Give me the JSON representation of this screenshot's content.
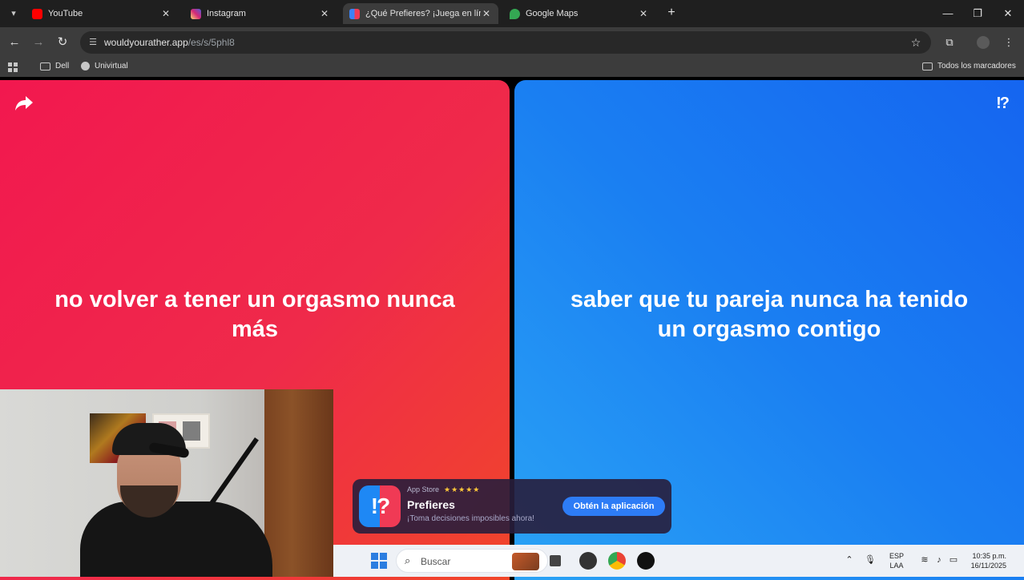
{
  "browser": {
    "tabs": [
      {
        "title": "YouTube",
        "favicon_color": "#ff0000",
        "active": false
      },
      {
        "title": "Instagram",
        "favicon_color": "#d62976",
        "active": false
      },
      {
        "title": "¿Qué Prefieres? ¡Juega en línea!",
        "favicon_color": "#3b82f6",
        "active": true
      },
      {
        "title": "Google Maps",
        "favicon_color": "#34a853",
        "active": false
      }
    ],
    "url_host": "wouldyourather.app",
    "url_path": "/es/s/5phl8",
    "bookmarks": [
      {
        "label": "Dell",
        "icon": "folder-icon"
      },
      {
        "label": "Univirtual",
        "icon": "globe-icon"
      }
    ],
    "all_bookmarks": "Todos los marcadores"
  },
  "game": {
    "option_a": "no volver a tener un orgasmo nunca más",
    "option_b": "saber que tu pareja nunca ha tenido un orgasmo contigo",
    "logo_mark": "!?",
    "color_a": "#f2184f",
    "color_b": "#1a7ff2"
  },
  "promo": {
    "store": "App Store",
    "stars": "★★★★★",
    "title": "Prefieres",
    "subtitle": "¡Toma decisiones imposibles ahora!",
    "button": "Obtén la aplicación",
    "icon_text": "!?"
  },
  "taskbar": {
    "search_placeholder": "Buscar",
    "lang_top": "ESP",
    "lang_bottom": "LAA",
    "time": "10:35 p.m.",
    "date": "16/11/2025"
  }
}
